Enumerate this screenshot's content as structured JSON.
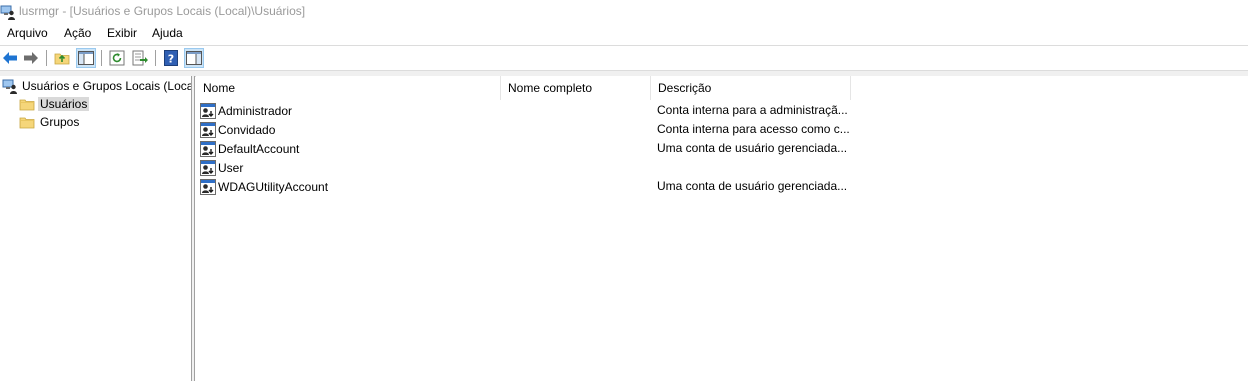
{
  "window": {
    "title": "lusrmgr - [Usuários e Grupos Locais (Local)\\Usuários]"
  },
  "menu": [
    "Arquivo",
    "Ação",
    "Exibir",
    "Ajuda"
  ],
  "toolbar": {
    "buttons": [
      "back-arrow-icon",
      "forward-arrow-icon",
      "up-folder-icon",
      "show-hide-tree-icon",
      "refresh-icon",
      "export-list-icon",
      "help-icon",
      "show-hide-action-pane-icon"
    ]
  },
  "tree": {
    "root": "Usuários e Grupos Locais (Local)",
    "children": [
      "Usuários",
      "Grupos"
    ],
    "selected": "Usuários"
  },
  "list": {
    "columns": [
      "Nome",
      "Nome completo",
      "Descrição"
    ],
    "rows": [
      {
        "name": "Administrador",
        "full_name": "",
        "description": "Conta interna para a administraçã..."
      },
      {
        "name": "Convidado",
        "full_name": "",
        "description": "Conta interna para acesso como c..."
      },
      {
        "name": "DefaultAccount",
        "full_name": "",
        "description": "Uma conta de usuário gerenciada..."
      },
      {
        "name": "User",
        "full_name": "",
        "description": ""
      },
      {
        "name": "WDAGUtilityAccount",
        "full_name": "",
        "description": "Uma conta de usuário gerenciada..."
      }
    ]
  },
  "colors": {
    "title_text": "#9a9a9a",
    "selection": "#d9d9d9",
    "folder": "#f5d67a",
    "accent_blue": "#1e74d2"
  }
}
